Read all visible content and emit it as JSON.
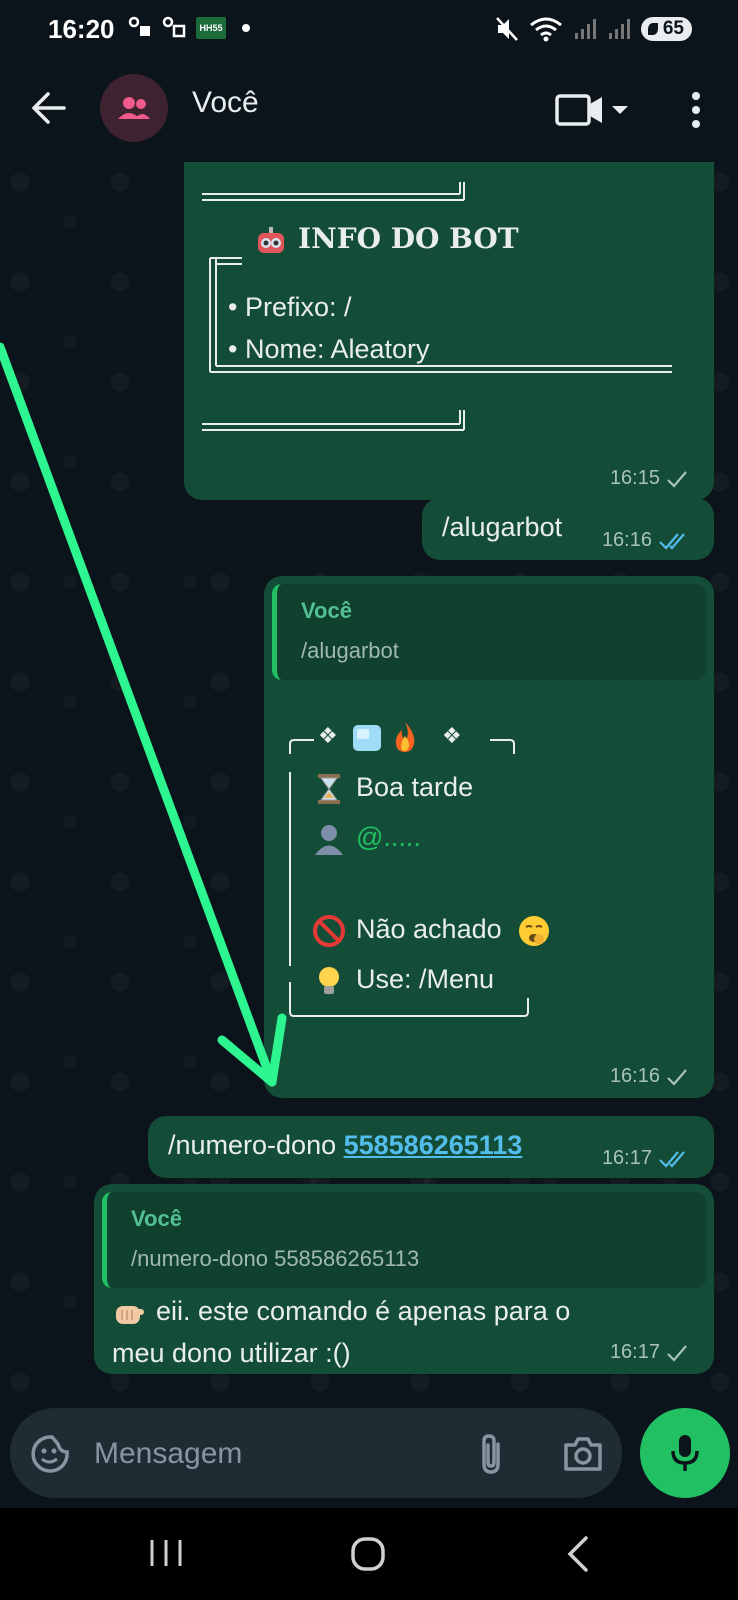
{
  "status_bar": {
    "time": "16:20",
    "carrier_badge": "HH55\n.com",
    "battery": "65"
  },
  "header": {
    "title": "Você"
  },
  "messages": {
    "bot_info": {
      "title": "INFO DO BOT",
      "prefix": "• Prefixo: /",
      "name": "• Nome: Aleatory",
      "time": "16:15"
    },
    "sent_alugarbot": {
      "text": "/alugarbot",
      "time": "16:16"
    },
    "reply_alugarbot": {
      "quote_name": "Você",
      "quote_text": "/alugarbot",
      "top_line": "❖",
      "top_line_end": "❖",
      "greeting": "Boa tarde",
      "mention": "@.....",
      "not_found": "Não achado",
      "use": "Use: /Menu",
      "time": "16:16"
    },
    "sent_numero": {
      "prefix": "/numero-dono ",
      "number": "558586265113",
      "time": "16:17"
    },
    "reply_numero": {
      "quote_name": "Você",
      "quote_text": "/numero-dono 558586265113",
      "text_line1": "eii. este comando é apenas para o",
      "text_line2": "meu dono utilizar :()",
      "time": "16:17"
    }
  },
  "input": {
    "placeholder": "Mensagem"
  },
  "colors": {
    "accent": "#21c063",
    "bubble": "#144d37",
    "arrow": "#2df58f",
    "read_tick": "#53bdeb"
  }
}
